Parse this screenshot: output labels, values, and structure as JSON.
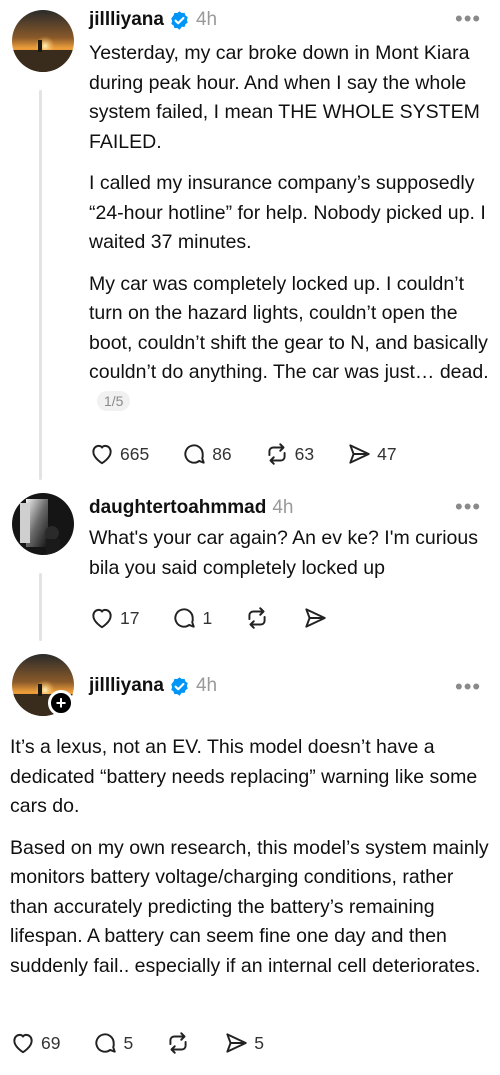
{
  "posts": [
    {
      "username": "jillliyana",
      "time": "4h",
      "paragraphs": [
        "Yesterday, my car broke down in Mont Kiara during peak hour. And when I say the whole system failed, I mean THE WHOLE SYSTEM FAILED.",
        "I called my insurance company’s supposedly “24-hour hotline” for help. Nobody picked up. I waited 37 minutes.",
        "My car was completely locked up. I couldn’t turn on the hazard lights, couldn’t open the boot, couldn’t shift the gear to N, and basically couldn’t do anything. The car was just… dead."
      ],
      "pager": "1/5",
      "likes": "665",
      "replies": "86",
      "reposts": "63",
      "shares": "47"
    },
    {
      "username": "daughtertoahmmad",
      "time": "4h",
      "text": "What's your car again? An ev ke? I'm curious bila you said completely locked up",
      "likes": "17",
      "replies": "1"
    },
    {
      "username": "jillliyana",
      "time": "4h",
      "plus": "+",
      "paragraphs": [
        "It’s a lexus, not an EV. This model doesn’t have a dedicated “battery needs replacing” warning like some cars do.",
        "Based on my own research, this model’s system mainly monitors battery voltage/charging conditions, rather than accurately predicting the battery’s remaining lifespan. A battery can seem fine one day and then suddenly fail.. especially if an internal cell deteriorates."
      ],
      "likes": "69",
      "replies": "5",
      "shares": "5"
    }
  ],
  "icons": {
    "verified": "verified-badge-icon",
    "like": "heart-icon",
    "reply": "comment-icon",
    "repost": "repost-icon",
    "share": "send-icon",
    "more": "more-dots-icon"
  },
  "colors": {
    "verified": "#0095f6",
    "text": "#101010",
    "muted": "#9a9a9a"
  }
}
